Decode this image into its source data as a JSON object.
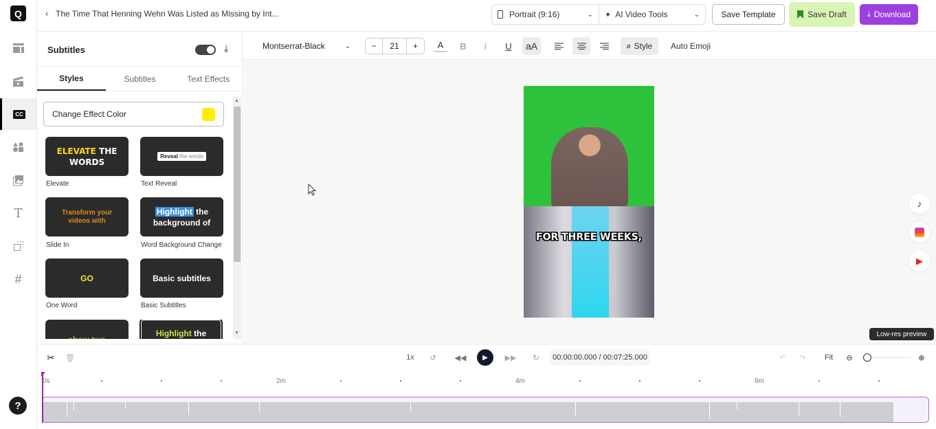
{
  "app": {
    "logo": "Q",
    "project_title": "The Time That Henning Wehn Was Listed as Missing by Int...",
    "back_icon": "‹"
  },
  "rail": {
    "items": [
      {
        "name": "templates",
        "icon": "▦"
      },
      {
        "name": "media",
        "icon": "🎬"
      },
      {
        "name": "subtitles",
        "icon": "CC",
        "active": true
      },
      {
        "name": "elements",
        "icon": "▲●"
      },
      {
        "name": "images",
        "icon": "🖼"
      },
      {
        "name": "text",
        "icon": "T"
      },
      {
        "name": "resize",
        "icon": "⬚"
      },
      {
        "name": "hashtag",
        "icon": "#"
      }
    ],
    "help": "?"
  },
  "header": {
    "aspect": "Portrait (9:16)",
    "ai_tools": "AI Video Tools",
    "save_template": "Save Template",
    "save_draft": "Save Draft",
    "download": "Download"
  },
  "panel": {
    "title": "Subtitles",
    "toggle_on": true,
    "tabs": [
      "Styles",
      "Subtitles",
      "Text Effects"
    ],
    "active_tab": "Styles",
    "effect_color_label": "Change Effect Color",
    "effect_color": "#ffee00",
    "styles": [
      {
        "label": "Elevate",
        "preview_a": "ELEVATE",
        "preview_b": " THE WORDS"
      },
      {
        "label": "Text Reveal",
        "preview_a": "Reveal",
        "preview_b": " the words"
      },
      {
        "label": "Slide In",
        "preview_a": "Transform your videos with"
      },
      {
        "label": "Word Background Change",
        "preview_a": "Highlight",
        "preview_b": " the background of"
      },
      {
        "label": "One Word",
        "preview_a": "GO"
      },
      {
        "label": "Basic Subtitles",
        "preview_a": "Basic subtitles"
      },
      {
        "label": "",
        "preview_a": "show two"
      },
      {
        "label": "",
        "preview_a": "Highlight",
        "preview_b": " the",
        "selected": true
      }
    ]
  },
  "toolbar": {
    "font": "Montserrat-Black",
    "size": "21",
    "minus": "−",
    "plus": "+",
    "color_btn": "A",
    "bold": "B",
    "italic": "I",
    "underline": "U",
    "case": "aA",
    "style": "Style",
    "auto_emoji": "Auto Emoji",
    "align_active": "center"
  },
  "preview": {
    "caption": "FOR THREE WEEKS,",
    "low_res": "Low-res preview",
    "socials": [
      "tiktok",
      "instagram-reels",
      "youtube-shorts"
    ]
  },
  "timeline": {
    "speed": "1x",
    "current_time": "00:00:00.000",
    "total_time": "00:07:25.000",
    "fit": "Fit",
    "ruler": [
      "0s",
      "2m",
      "4m",
      "6m"
    ],
    "zoom_level": 0
  }
}
